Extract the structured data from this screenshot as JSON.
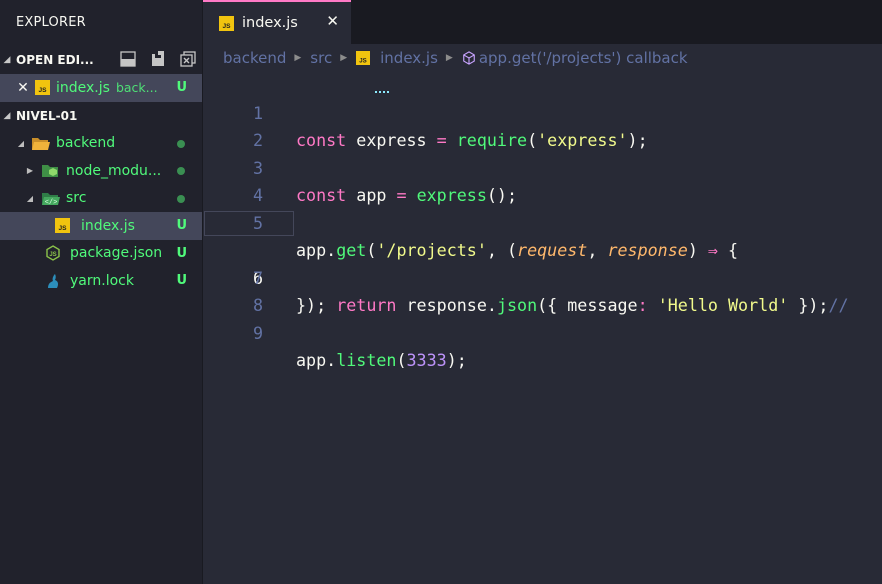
{
  "sidebar": {
    "title": "EXPLORER",
    "open_editors": {
      "label": "OPEN EDI...",
      "items": [
        {
          "name": "index.js",
          "desc": "back...",
          "status": "U"
        }
      ]
    },
    "workspace": {
      "label": "NIVEL-01",
      "items": [
        {
          "name": "backend",
          "status": ""
        },
        {
          "name": "node_modu...",
          "status": ""
        },
        {
          "name": "src",
          "status": ""
        },
        {
          "name": "index.js",
          "status": "U"
        },
        {
          "name": "package.json",
          "status": "U"
        },
        {
          "name": "yarn.lock",
          "status": "U"
        }
      ]
    }
  },
  "tabs": [
    {
      "label": "index.js",
      "close": "✕",
      "icon": "js-file-icon"
    }
  ],
  "breadcrumb": {
    "items": [
      "backend",
      "src",
      "index.js",
      "app.get('/projects') callback"
    ]
  },
  "editor": {
    "line_numbers": [
      "1",
      "2",
      "3",
      "4",
      "5",
      "6",
      "7",
      "8",
      "9"
    ],
    "current_line": 6,
    "tokens": {
      "l1": [
        "const",
        "express",
        "=",
        "require",
        "(",
        "'express'",
        ");"
      ],
      "l3": [
        "const",
        "app",
        "=",
        "express",
        "();"
      ],
      "l5": [
        "app.",
        "get",
        "(",
        "'/projects'",
        ", (",
        "request",
        ",",
        "response",
        ")",
        "⇒",
        "{"
      ],
      "l6": [
        "return",
        "response.",
        "json",
        "({",
        "message",
        ":",
        "'Hello World'",
        "});",
        "//"
      ],
      "l7": [
        "});"
      ],
      "l9": [
        "app.",
        "listen",
        "(",
        "3333",
        ");"
      ]
    }
  },
  "colors": {
    "accent": "#ff79c6",
    "git_untracked": "#50fa7b",
    "background": "#282a36"
  }
}
